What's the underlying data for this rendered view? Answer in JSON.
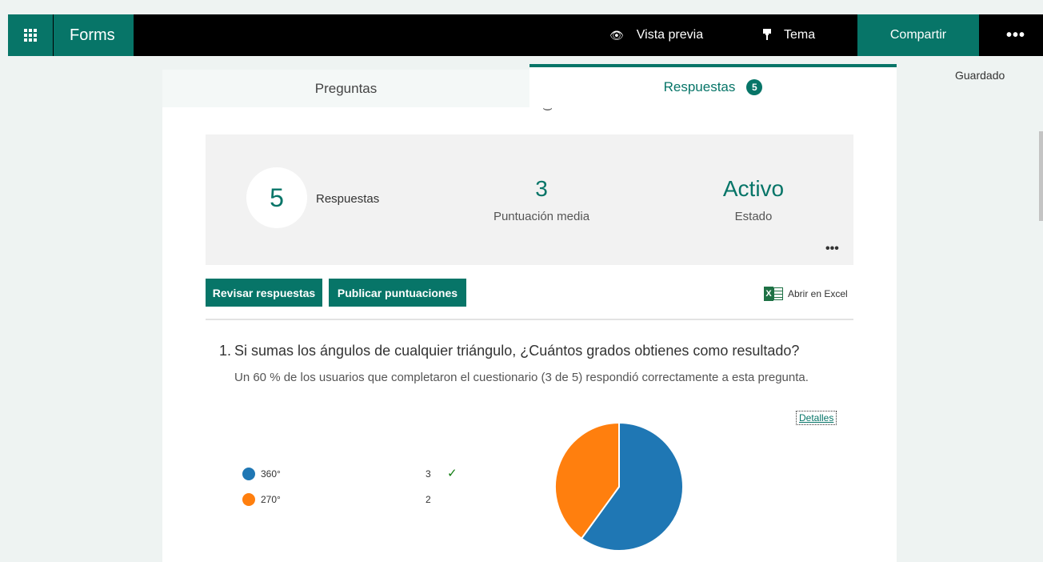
{
  "app": {
    "name": "Forms",
    "saved_status": "Guardado"
  },
  "topbar": {
    "preview_label": "Vista previa",
    "theme_label": "Tema",
    "share_label": "Compartir",
    "more_label": "•••",
    "icons": [
      "waffle-icon",
      "eye-icon",
      "paint-brush-icon",
      "more-icon"
    ]
  },
  "tabs": [
    {
      "label": "Preguntas",
      "active": false
    },
    {
      "label": "Respuestas",
      "badge": "5",
      "active": true
    }
  ],
  "summary": {
    "responses_value": "5",
    "responses_label": "Respuestas",
    "avg_score_value": "3",
    "avg_score_label": "Puntuación media",
    "status_value": "Activo",
    "status_label": "Estado",
    "more_label": "•••"
  },
  "actions": {
    "review_label": "Revisar respuestas",
    "publish_label": "Publicar puntuaciones",
    "excel_label": "Abrir en Excel",
    "excel_icon_text": "X"
  },
  "question": {
    "number": "1.",
    "text": "Si sumas los ángulos de cualquier triángulo, ¿Cuántos grados obtienes como resultado?",
    "stats_text": "Un 60 % de los usuarios que completaron el cuestionario (3 de 5) respondió correctamente a esta pregunta.",
    "details_label": "Detalles"
  },
  "chart_data": {
    "type": "pie",
    "series": [
      {
        "name": "360°",
        "value": 3,
        "color": "#1f77b4",
        "correct": true
      },
      {
        "name": "270°",
        "value": 2,
        "color": "#ff7f0e",
        "correct": false
      }
    ]
  },
  "colors": {
    "accent": "#077568",
    "correct_check": "#107c10"
  }
}
